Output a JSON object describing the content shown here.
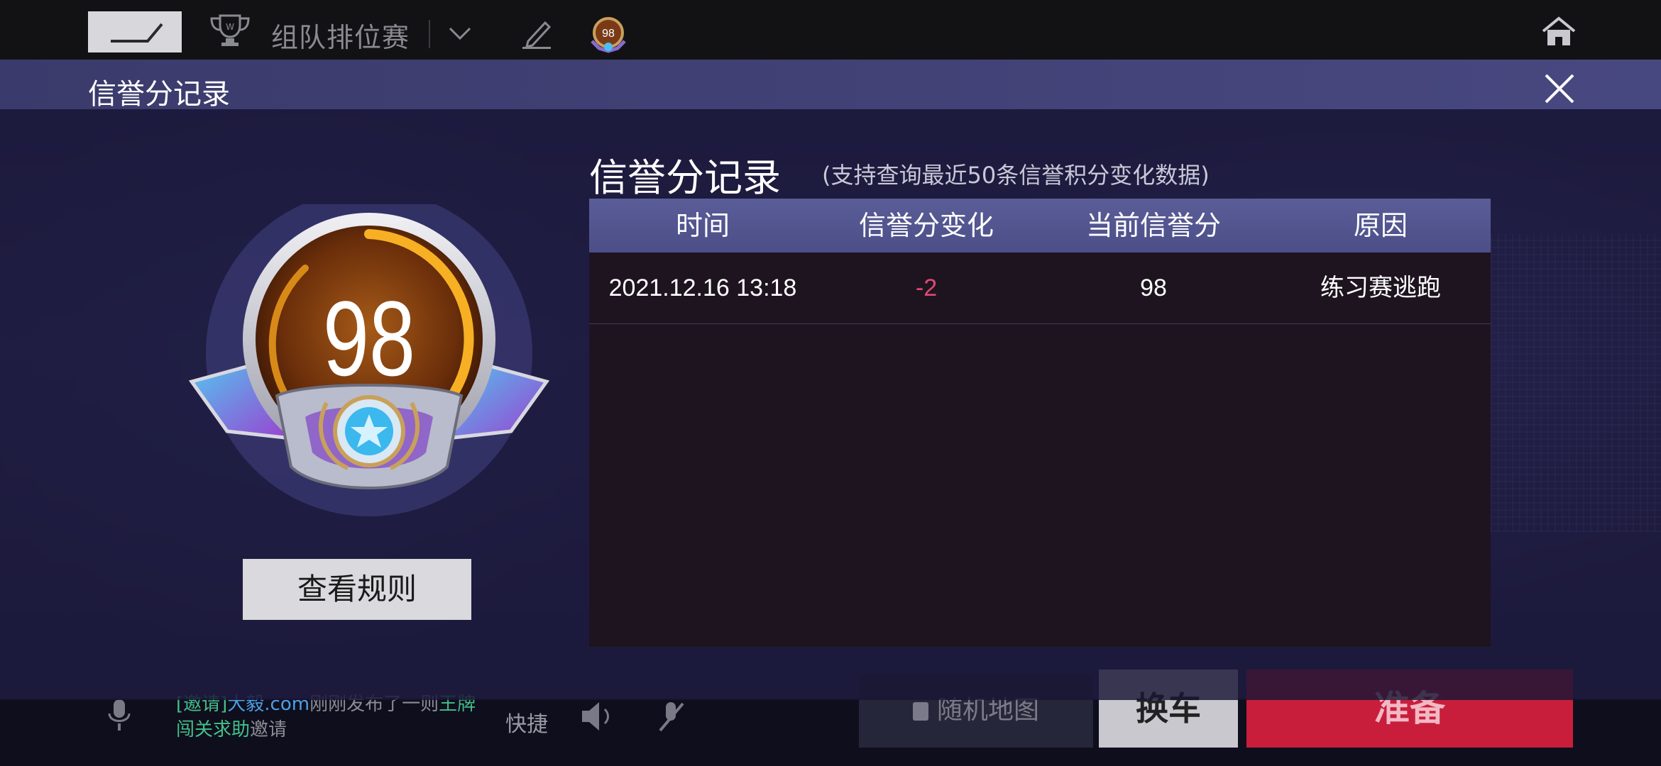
{
  "topbar": {
    "mode_title": "组队排位赛",
    "mini_badge_score": "98"
  },
  "background": {
    "chat_message_parts": [
      "[邀请]",
      "大毅.com",
      "刚刚发布了一则",
      "王牌闯关求助",
      "邀请"
    ],
    "quick_label": "快捷",
    "random_map_label": "随机地图",
    "change_car_label": "换车",
    "ready_label": "准备"
  },
  "dialog": {
    "title": "信誉分记录",
    "score": "98",
    "rules_button": "查看规则",
    "panel_heading": "信誉分记录",
    "panel_note": "(支持查询最近50条信誉积分变化数据)",
    "table": {
      "headers": [
        "时间",
        "信誉分变化",
        "当前信誉分",
        "原因"
      ],
      "rows": [
        {
          "time": "2021.12.16 13:18",
          "change": "-2",
          "current": "98",
          "reason": "练习赛逃跑"
        }
      ]
    }
  },
  "colors": {
    "negative_change": "#e04a6e",
    "table_header": "#5b5d98",
    "table_body": "#1e1420"
  },
  "icons": [
    "back-icon",
    "trophy-icon",
    "chevron-down-icon",
    "edit-icon",
    "credit-badge-icon",
    "home-icon",
    "close-icon",
    "mic-icon",
    "speaker-icon",
    "mute-icon",
    "lock-icon"
  ]
}
